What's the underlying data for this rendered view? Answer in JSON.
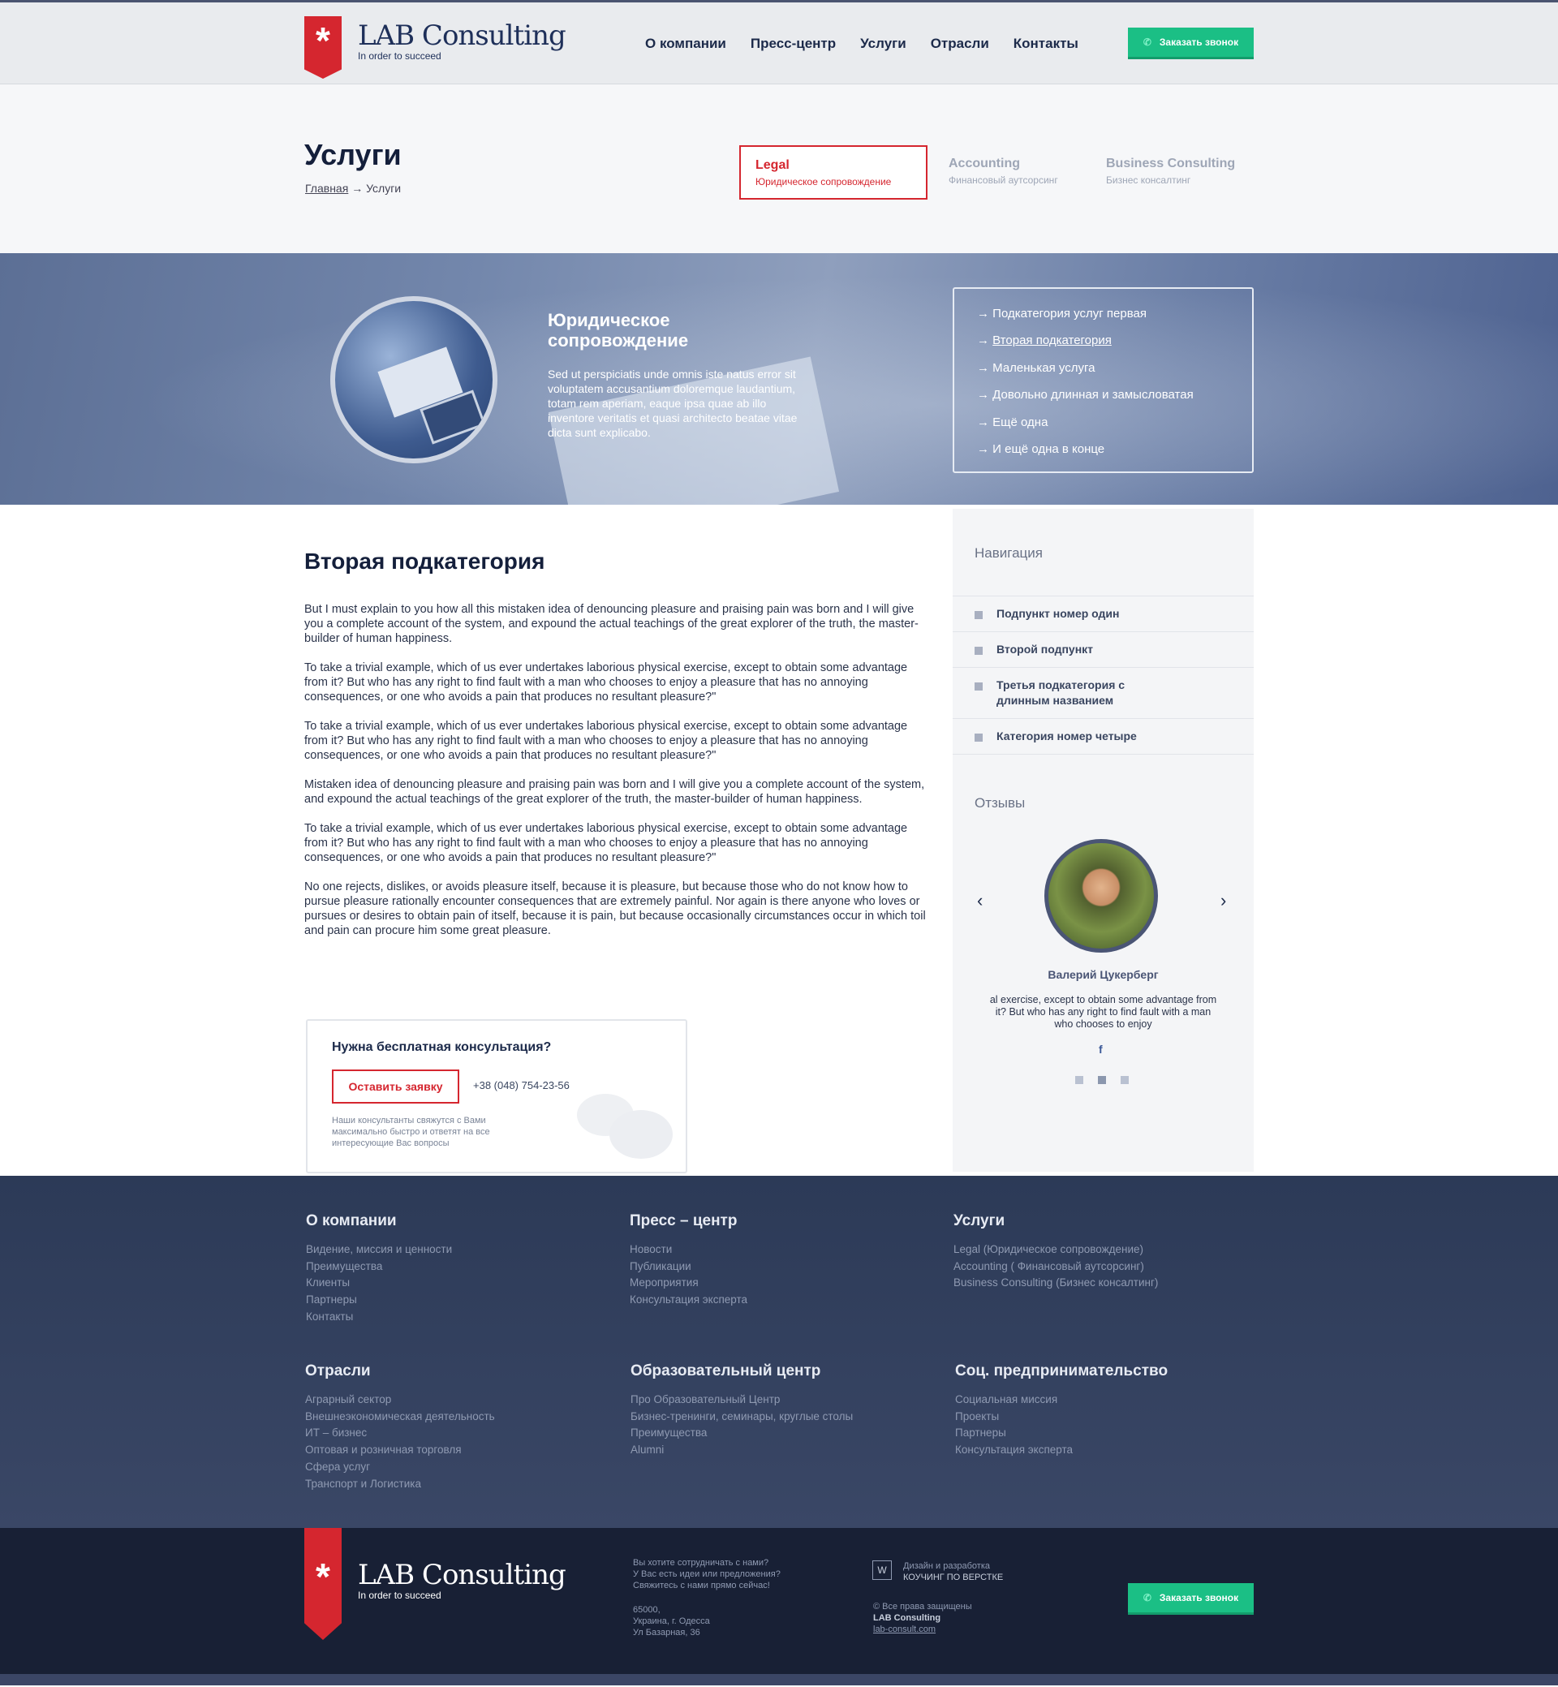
{
  "header": {
    "logo_name": "LAB Consulting",
    "logo_tag": "In order to succeed",
    "nav": [
      "О компании",
      "Пресс-центр",
      "Услуги",
      "Отрасли",
      "Контакты"
    ],
    "call_label": "Заказать звонок"
  },
  "title": {
    "heading": "Услуги",
    "crumb_home": "Главная",
    "crumb_sep": "→",
    "crumb_current": "Услуги"
  },
  "services": [
    {
      "title": "Legal",
      "sub": "Юридическое сопровождение"
    },
    {
      "title": "Accounting",
      "sub": "Финансовый аутсорсинг"
    },
    {
      "title": "Business Consulting",
      "sub": "Бизнес консалтинг"
    }
  ],
  "hero": {
    "title_line1": "Юридическое",
    "title_line2": "сопровождение",
    "text": "Sed ut perspiciatis unde omnis iste natus error sit voluptatem accusantium doloremque laudantium, totam rem aperiam, eaque ipsa quae ab illo inventore veritatis et quasi architecto beatae vitae dicta sunt explicabo.",
    "subcategories": [
      "Подкатегория услуг первая",
      "Вторая подкатегория",
      "Маленькая услуга",
      "Довольно длинная и замысловатая",
      "Ещё одна",
      "И ещё одна в конце"
    ]
  },
  "content": {
    "heading": "Вторая подкатегория",
    "paragraphs": [
      "But I must explain to you how all this mistaken idea of denouncing pleasure and praising pain was born and I will give you a complete account of the system, and expound the actual teachings of the great explorer of the truth, the master-builder of human happiness.",
      "To take a trivial example, which of us ever undertakes laborious physical exercise, except to obtain some advantage from it? But who has any right to find fault with a man who chooses to enjoy a pleasure that has no annoying consequences, or one who avoids a pain that produces no resultant pleasure?\"",
      "To take a trivial example, which of us ever undertakes laborious physical exercise, except to obtain some advantage from it? But who has any right to find fault with a man who chooses to enjoy a pleasure that has no annoying consequences, or one who avoids a pain that produces no resultant pleasure?\"",
      "Mistaken idea of denouncing pleasure and praising pain was born and I will give you a complete account of the system, and expound the actual teachings of the great explorer of the truth, the master-builder of human happiness.",
      "To take a trivial example, which of us ever undertakes laborious physical exercise, except to obtain some advantage from it? But who has any right to find fault with a man who chooses to enjoy a pleasure that has no annoying consequences, or one who avoids a pain that produces no resultant pleasure?\"",
      "No one rejects, dislikes, or avoids pleasure itself, because it is pleasure, but because those who do not know how to pursue pleasure rationally encounter consequences that are extremely painful. Nor again is there anyone who loves or pursues or desires to obtain pain of itself, because it is pain, but because occasionally circumstances occur in which toil and pain can procure him some great pleasure."
    ]
  },
  "consult": {
    "question": "Нужна бесплатная консультация?",
    "button": "Оставить заявку",
    "phone": "+38 (048) 754-23-56",
    "note": "Наши консультанты свяжутся с Вами максимально быстро и ответят на все интересующие Вас вопросы"
  },
  "sidebar": {
    "nav_heading": "Навигация",
    "nav_items": [
      "Подпункт номер один",
      "Второй подпункт",
      "Третья подкатегория с длинным названием",
      "Категория номер четыре"
    ],
    "reviews_heading": "Отзывы",
    "reviewer": "Валерий Цукерберг",
    "review_text": "al exercise, except to obtain some advantage from it? But who has any right to find fault with a man who chooses to enjoy",
    "fb": "f",
    "prev": "‹",
    "next": "›"
  },
  "footer": {
    "cols": [
      {
        "heading": "О компании",
        "links": [
          "Видение, миссия и ценности",
          "Преимущества",
          "Клиенты",
          "Партнеры",
          "Контакты"
        ]
      },
      {
        "heading": "Пресс – центр",
        "links": [
          "Новости",
          "Публикации",
          "Мероприятия",
          "Консультация эксперта"
        ]
      },
      {
        "heading": "Услуги",
        "links": [
          "Legal (Юридическое сопровождение)",
          "Accounting ( Финансовый аутсорсинг)",
          "Business Consulting (Бизнес консалтинг)"
        ]
      },
      {
        "heading": "Отрасли",
        "links": [
          "Аграрный сектор",
          "Внешнеэкономическая деятельность",
          "ИТ – бизнес",
          "Оптовая и розничная торговля",
          "Сфера услуг",
          "Транспорт и Логистика"
        ]
      },
      {
        "heading": "Образовательный центр",
        "links": [
          "Про Образовательный Центр",
          "Бизнес-тренинги, семинары, круглые столы",
          "Преимущества",
          "Alumni"
        ]
      },
      {
        "heading": "Соц. предпринимательство",
        "links": [
          "Социальная миссия",
          "Проекты",
          "Партнеры",
          "Консультация эксперта"
        ]
      }
    ]
  },
  "bottom": {
    "cta_line1": "Вы хотите сотрудничать с нами?",
    "cta_line2": "У Вас есть идеи или предложения?",
    "cta_line3": "Свяжитесь с нами прямо сейчас!",
    "addr_line1": "65000,",
    "addr_line2": "Украина, г. Одесса",
    "addr_line3": "Ул Базарная, 36",
    "dev_box": "W",
    "dev_line1": "Дизайн и разработка",
    "dev_line2": "КОУЧИНГ ПО ВЕРСТКЕ",
    "copy_line1": "© Все права защищены",
    "copy_line2": "LAB Consulting",
    "copy_line3": "lab-consult.com",
    "call_label": "Заказать звонок"
  },
  "colors": {
    "brand_red": "#d5262f",
    "accent_green": "#1bbf85",
    "navy": "#1c2a4a"
  }
}
